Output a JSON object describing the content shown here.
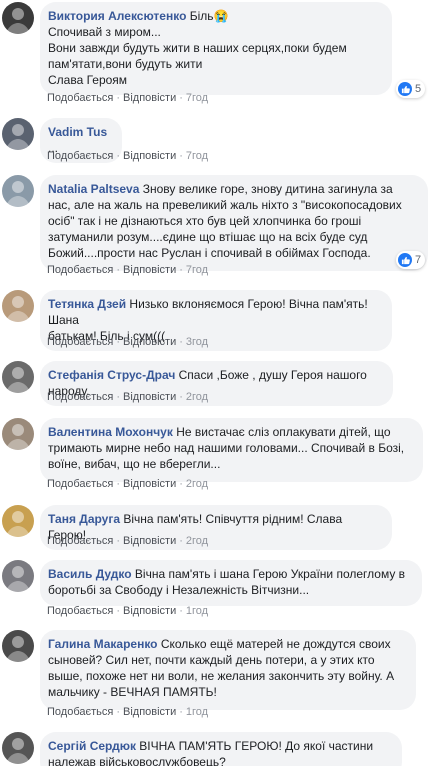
{
  "actions": {
    "like": "Подобається",
    "reply": "Відповісти",
    "sep": "·"
  },
  "comments": [
    {
      "author": "Виктория Алексютенко",
      "text": " Біль😭\nСпочивай з миром...\nВони завжди будуть жити в наших серцях,поки будем\nпам'ятати,вони будуть жити\nСлава Героям",
      "time": "7год",
      "likes": "5",
      "avatar_color": "#3a3a3a"
    },
    {
      "author": "Vadim Tus",
      "text": " ...",
      "time": "7год",
      "avatar_color": "#5a6270"
    },
    {
      "author": "Natalia Paltseva",
      "text": " Знову велике горе, знову дитина загинула за\nнас, але на жаль на превеликий жаль ніхто з \"високопосадових\nосіб\" так і не дізнаються хто був цей хлопчинка бо гроші\nзатуманили розум....єдине що втішає що на всіх буде суд\nБожий....прости нас Руслан і спочивай в обіймах Господа.",
      "time": "7год",
      "likes": "7",
      "avatar_color": "#8a9aa8"
    },
    {
      "author": "Тетянка Дзей",
      "text": " Низько вклоняємося Герою! Вічна пам'ять! Шана\nбатькам! Біль і сум(((",
      "time": "3год",
      "avatar_color": "#b89a7a"
    },
    {
      "author": "Стефанія Струс-Драч",
      "text": " Спаси ,Боже , душу Героя нашого народу.",
      "time": "2год",
      "avatar_color": "#6a6a6a"
    },
    {
      "author": "Валентина Мохончук",
      "text": " Не вистачає сліз оплакувати дітей, що\nтримають мирне небо над нашими головами... Спочивай в Бозі,\nвоїне, вибач, що не вберегли...",
      "time": "2год",
      "avatar_color": "#9a8a7a"
    },
    {
      "author": "Таня Даруга",
      "text": " Вічна пам'ять! Співчуття рідним! Слава Герою!",
      "time": "2год",
      "avatar_color": "#c8a050"
    },
    {
      "author": "Василь Дудко",
      "text": " Вічна пам'ять і шана Герою України полеглому в\nборотьбі за Свободу і Незалежність Вітчизни...",
      "time": "1год",
      "avatar_color": "#7a7a80"
    },
    {
      "author": "Галина Макаренко",
      "text": " Сколько ещё матерей не дождутся своих\nсыновей? Сил нет, почти каждый день потери, а у этих кто\nвыше, похоже нет ни воли, не желания закончить эту войну. А\nмальчику - ВЕЧНАЯ ПАМЯТЬ!",
      "time": "1год",
      "avatar_color": "#4a4a4a"
    },
    {
      "author": "Сергій Сердюк",
      "text": " ВІЧНА ПАМ'ЯТЬ ГЕРОЮ! До якої частини\nналежав військовослужбовець?",
      "time": "",
      "avatar_color": "#555555"
    }
  ]
}
